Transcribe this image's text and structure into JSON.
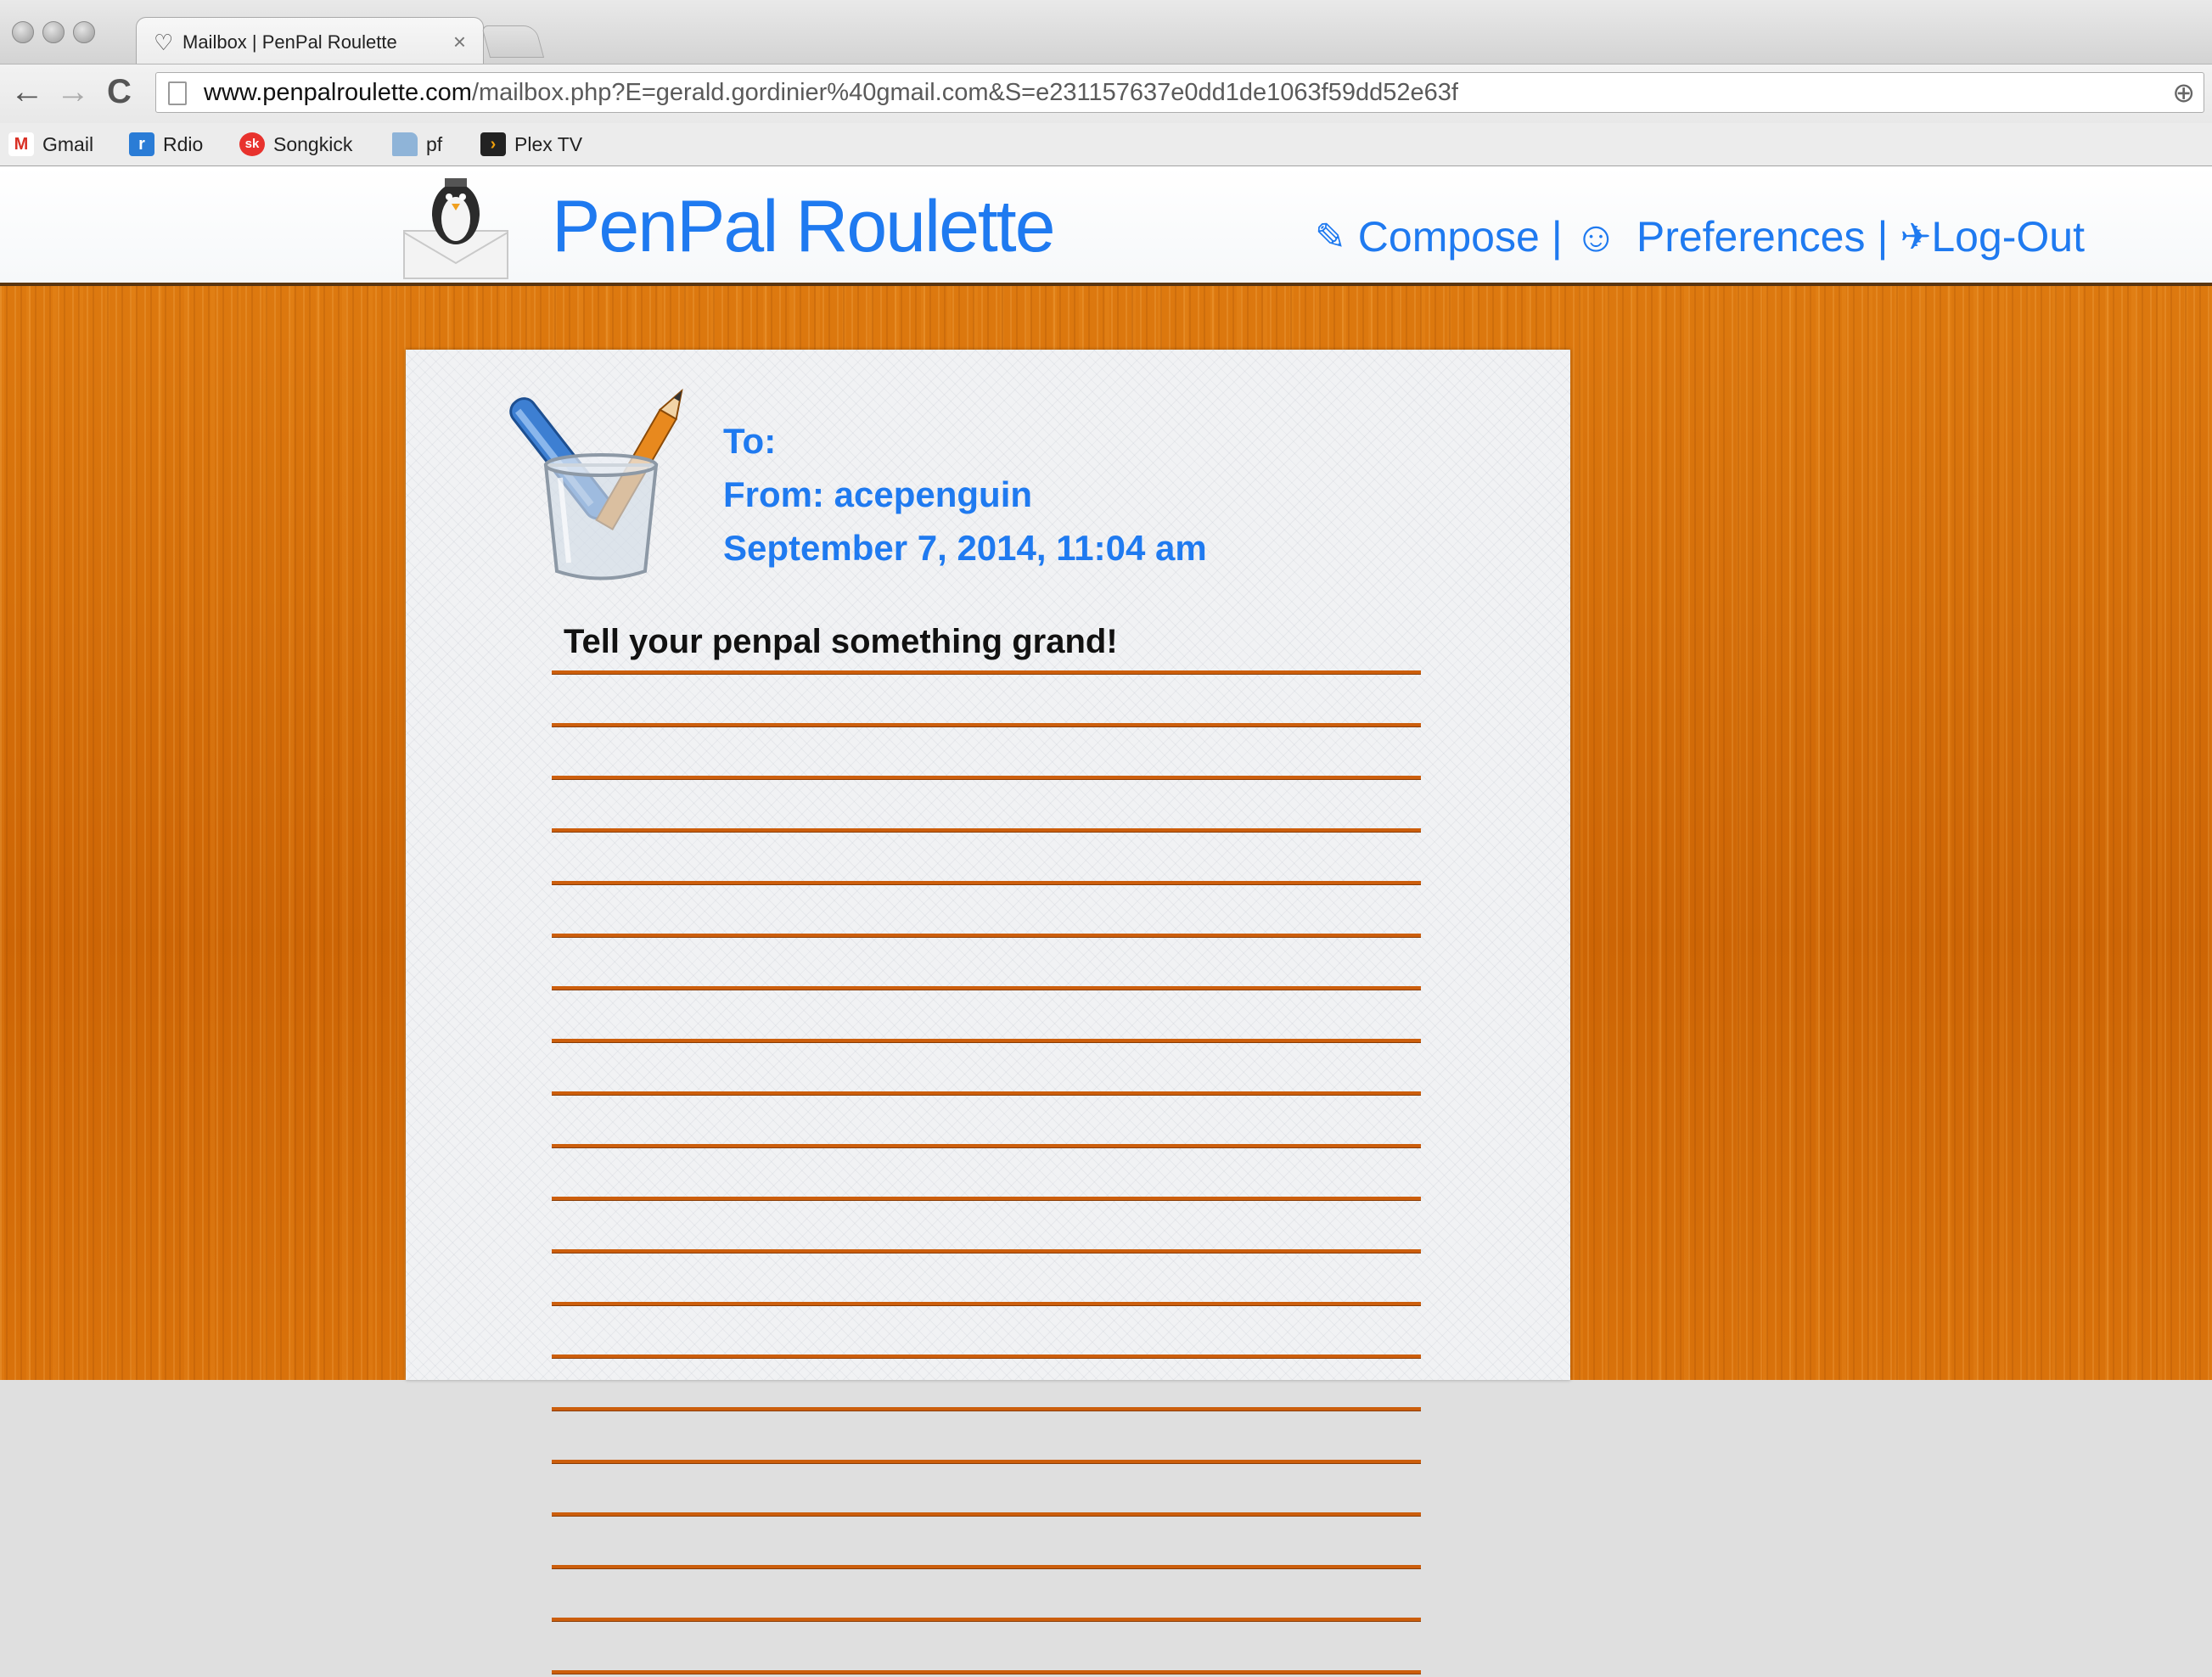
{
  "browser": {
    "tab_title": "Mailbox | PenPal Roulette",
    "tab_close": "×",
    "url_host": "www.penpalroulette.com",
    "url_path": "/mailbox.php?E=gerald.gordinier%40gmail.com&S=e231157637e0dd1de1063f59dd52e63f",
    "back_icon": "←",
    "forward_icon": "→",
    "reload_icon": "C",
    "zoom_icon": "⊕",
    "bookmarks": [
      {
        "label": "Gmail",
        "icon": "gmail-icon",
        "icon_glyph": "M",
        "color": "#d93025"
      },
      {
        "label": "Rdio",
        "icon": "rdio-icon",
        "icon_glyph": "r",
        "color": "#2a7cd6"
      },
      {
        "label": "Songkick",
        "icon": "songkick-icon",
        "icon_glyph": "sk",
        "color": "#e8322d"
      },
      {
        "label": "pf",
        "icon": "folder-icon",
        "icon_glyph": "",
        "color": "#8fb4d8"
      },
      {
        "label": "Plex TV",
        "icon": "plex-icon",
        "icon_glyph": "›",
        "color": "#222222"
      }
    ]
  },
  "site": {
    "title": "PenPal Roulette",
    "accent_color": "#1f7af0",
    "nav": {
      "compose_icon": "✎",
      "compose": "Compose",
      "separator": "|",
      "preferences_icon": "☺",
      "preferences": "Preferences",
      "logout_icon": "✈",
      "logout": "Log-Out"
    }
  },
  "letter": {
    "to_label": "To:",
    "from_line": "From: acepenguin",
    "date": "September 7, 2014, 11:04 am",
    "placeholder": "Tell your penpal something grand!",
    "rule_color": "#cc5e0c"
  }
}
